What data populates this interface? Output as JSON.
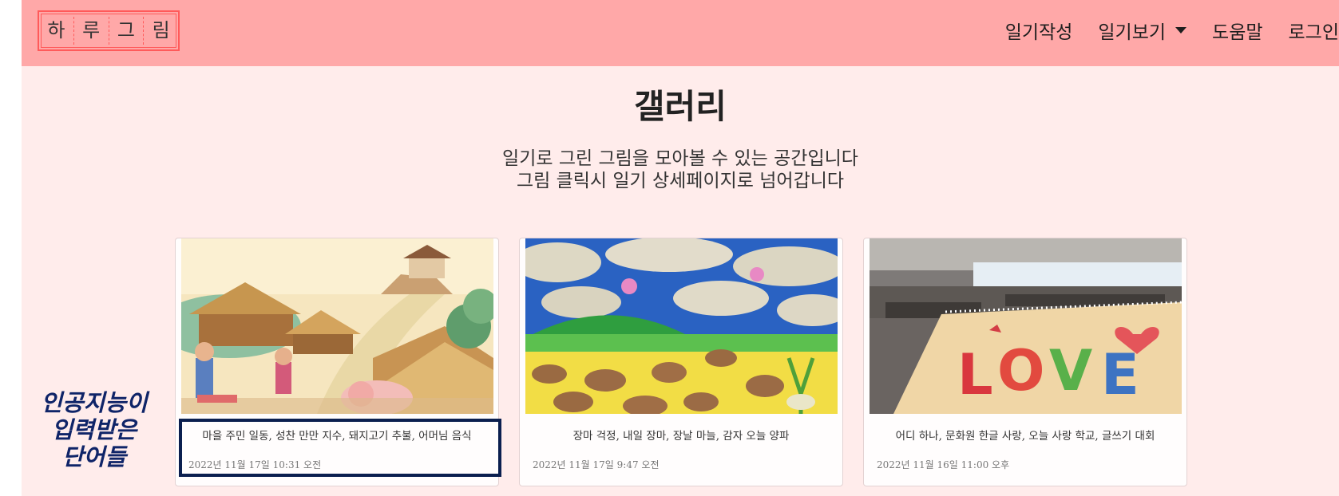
{
  "navbar": {
    "logo_chars": [
      "하",
      "루",
      "그",
      "림"
    ],
    "menu": {
      "write": "일기작성",
      "view": "일기보기",
      "help": "도움말",
      "login": "로그인"
    }
  },
  "gallery": {
    "title": "갤러리",
    "subtitle_line1": "일기로 그린 그림을 모아볼 수 있는 공간입니다",
    "subtitle_line2": "그림 클릭시 일기 상세페이지로 넘어갑니다"
  },
  "cards": [
    {
      "words": "마을 주민 일동, 성찬 만만 지수, 돼지고기 추불, 어머님 음식",
      "date": "2022년 11월 17일 10:31 오전"
    },
    {
      "words": "장마 걱정, 내일 장마, 장날 마늘, 감자 오늘 양파",
      "date": "2022년 11월 17일 9:47 오전"
    },
    {
      "words": "어디 하나, 문화원 한글 사랑, 오늘 사랑 학교, 글쓰기 대회",
      "date": "2022년 11월 16일 11:00 오후"
    }
  ],
  "annotation": {
    "line1": "인공지능이",
    "line2": "입력받은",
    "line3": "단어들"
  },
  "colors": {
    "navbar_bg": "#ffa8a8",
    "page_bg": "#ffeceb",
    "highlight_border": "#0b1f4f",
    "annotation_text": "#0f2468"
  }
}
